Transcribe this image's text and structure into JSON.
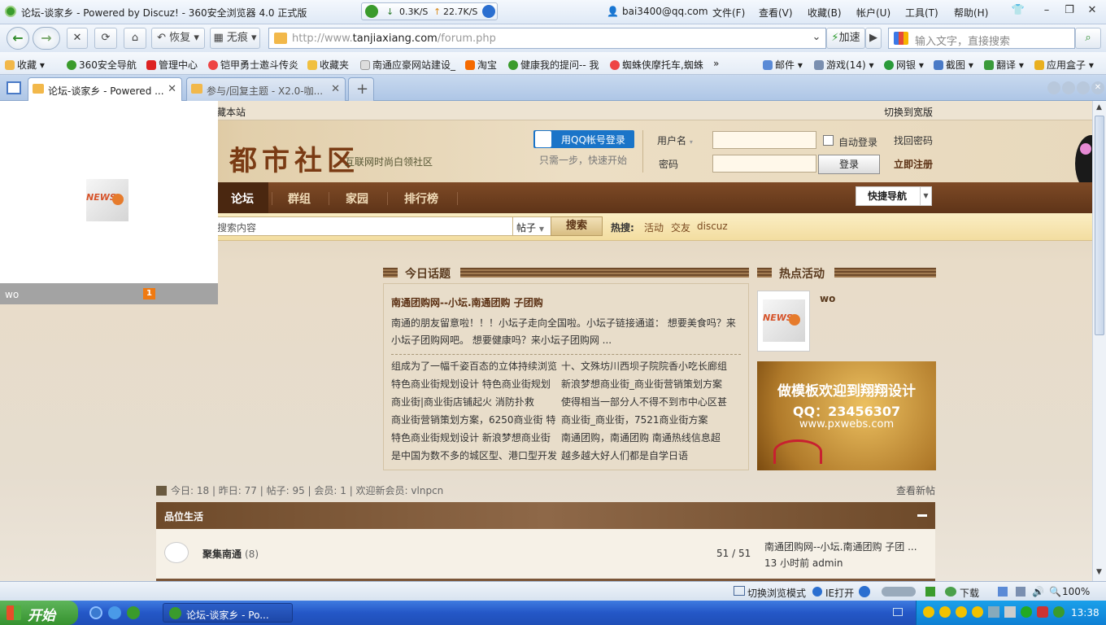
{
  "window": {
    "title": "论坛-谈家乡 - Powered by Discuz! - 360安全浏览器 4.0 正式版",
    "download_speed": "0.3K/S",
    "upload_speed": "22.7K/S",
    "user_email": "bai3400@qq.com",
    "menu": [
      "文件(F)",
      "查看(V)",
      "收藏(B)",
      "帐户(U)",
      "工具(T)",
      "帮助(H)"
    ]
  },
  "toolbar": {
    "restore_label": "恢复",
    "traceless_label": "无痕",
    "accelerate_label": "加速",
    "url_prefix": "http://www.",
    "url_domain": "tanjiaxiang.com",
    "url_path": "/forum.php",
    "search_placeholder": "输入文字，直接搜索"
  },
  "favorites": {
    "left": [
      "收藏",
      "360安全导航",
      "管理中心",
      "铠甲勇士邀斗传炎",
      "收藏夹",
      "南通应豪网站建设_",
      "淘宝",
      "健康我的提问-- 我",
      "蜘蛛侠摩托车,蜘蛛"
    ],
    "more": "»",
    "right": [
      "邮件",
      "游戏(14)",
      "网银",
      "截图",
      "翻译",
      "应用盒子"
    ]
  },
  "tabs": [
    {
      "label": "论坛-谈家乡 - Powered ..."
    },
    {
      "label": "参与/回复主题 - X2.0-咖..."
    }
  ],
  "site": {
    "topstrip_left": "藏本站",
    "topstrip_right": "切换到宽版",
    "logo": "都市社区",
    "slogan": "互联网时尚白领社区",
    "qq_login": "用QQ帐号登录",
    "qq_sub": "只需一步，快速开始",
    "username_label": "用户名",
    "password_label": "密码",
    "auto_login": "自动登录",
    "login_button": "登录",
    "find_password": "找回密码",
    "register": "立即注册",
    "nav": [
      "论坛",
      "群组",
      "家园",
      "排行榜"
    ],
    "quick_nav": "快捷导航",
    "search_placeholder": "搜索内容",
    "search_type": "帖子",
    "search_button": "搜索",
    "hot_label": "热搜:",
    "hot_terms": [
      "活动",
      "交友",
      "discuz"
    ]
  },
  "today": {
    "title": "今日话题",
    "headline": "南通团购网--小坛.南通团购  子团购",
    "summary": "南通的朋友留意啦！！！小坛子走向全国啦。小坛子链接通道： 想要美食吗？来小坛子团购网吧。 想要健康吗？来小坛子团购网 ...",
    "links_left": [
      "组成为了一幅千姿百态的立体持续浏览",
      "特色商业街规划设计  特色商业街规划",
      "商业街|商业街店铺起火  消防扑救",
      "商业街营销策划方案，6250商业街  特",
      "特色商业街规划设计  新浪梦想商业街",
      "是中国为数不多的城区型、港口型开发"
    ],
    "links_right": [
      "十、文殊坊川西坝子院院香小吃长廊组",
      "新浪梦想商业街_商业街营销策划方案",
      "使得相当一部分人不得不到市中心区甚",
      "商业街_商业街，7521商业街方案",
      "南通团购，南通团购   南通热线信息超",
      "越多越大好人们都是自学日语"
    ]
  },
  "hot_activity": {
    "title": "热点活动",
    "user": "wo",
    "ad_line1": "做模板欢迎到翔翔设计",
    "ad_line2": "QQ：23456307",
    "ad_line3": "www.pxwebs.com"
  },
  "stats": {
    "text": "今日: 18 | 昨日: 77 | 帖子: 95 | 会员: 1 | 欢迎新会员: vlnpcn",
    "view_new": "查看新帖"
  },
  "category": {
    "title": "品位生活"
  },
  "forum": {
    "name": "聚集南通",
    "today_count": "(8)",
    "counts": "51 / 51",
    "last_title": "南通团购网--小坛.南通团购  子团 ...",
    "last_meta": "13 小时前  admin"
  },
  "popup": {
    "user": "wo",
    "badge": "1"
  },
  "statusbar": {
    "switch_mode": "切换浏览模式",
    "ie_open": "IE打开",
    "download": "下载",
    "zoom": "100%"
  },
  "taskbar": {
    "start": "开始",
    "app": "论坛-谈家乡 - Po...",
    "time": "13:38"
  }
}
